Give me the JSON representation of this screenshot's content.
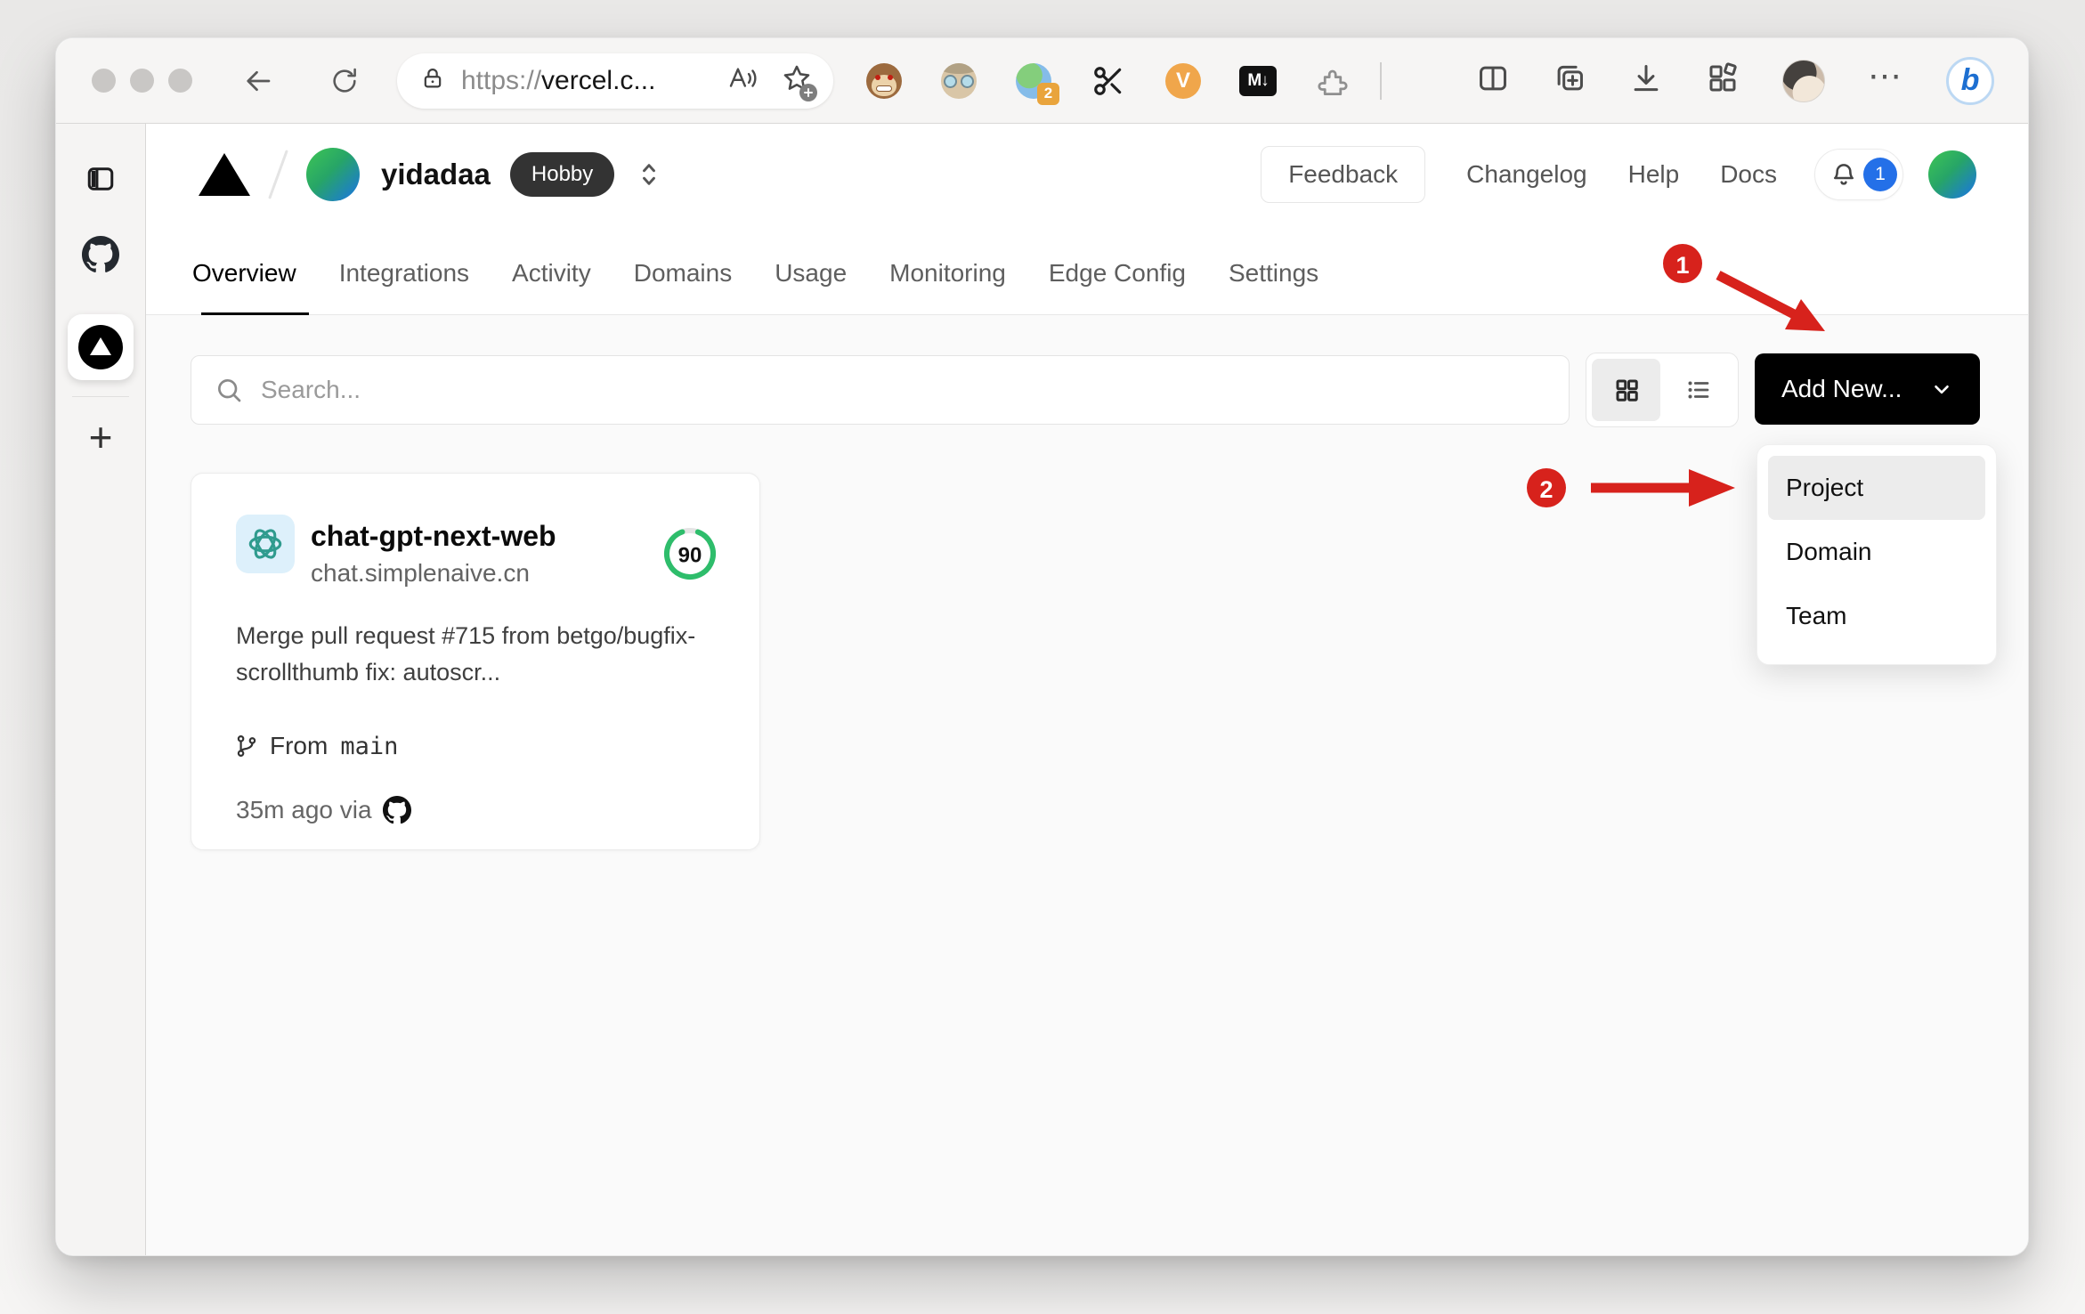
{
  "browser": {
    "url": {
      "scheme": "https://",
      "host": "vercel.c..."
    },
    "icons": {
      "tab_ext_badge": "2",
      "v_extension_label": "V",
      "markdown_extension_label": "M↓",
      "more_label": "⋯",
      "bing_label": "b",
      "new_tab_label": "+"
    }
  },
  "vercel": {
    "team": {
      "name": "yidadaa",
      "plan": "Hobby"
    },
    "header": {
      "feedback": "Feedback",
      "changelog": "Changelog",
      "help": "Help",
      "docs": "Docs",
      "notification_count": "1"
    },
    "tabs": [
      {
        "label": "Overview",
        "active": true
      },
      {
        "label": "Integrations",
        "active": false
      },
      {
        "label": "Activity",
        "active": false
      },
      {
        "label": "Domains",
        "active": false
      },
      {
        "label": "Usage",
        "active": false
      },
      {
        "label": "Monitoring",
        "active": false
      },
      {
        "label": "Edge Config",
        "active": false
      },
      {
        "label": "Settings",
        "active": false
      }
    ],
    "toolbar": {
      "search_placeholder": "Search...",
      "add_new": "Add New..."
    },
    "dropdown": [
      {
        "label": "Project",
        "highlighted": true
      },
      {
        "label": "Domain",
        "highlighted": false
      },
      {
        "label": "Team",
        "highlighted": false
      }
    ],
    "project": {
      "name": "chat-gpt-next-web",
      "domain": "chat.simplenaive.cn",
      "score": "90",
      "commit_message": "Merge pull request #715 from betgo/bugfix-scrollthumb fix: autoscr...",
      "branch_label": "From",
      "branch_name": "main",
      "deployed_meta": "35m ago via"
    }
  },
  "annotations": {
    "step1": "1",
    "step2": "2"
  },
  "colors": {
    "annotation_red": "#d7221c",
    "score_green": "#2ebd6b",
    "notification_blue": "#2470e8",
    "plan_badge_bg": "#333333",
    "add_button_bg": "#000000",
    "main_bg": "#fafafa"
  }
}
